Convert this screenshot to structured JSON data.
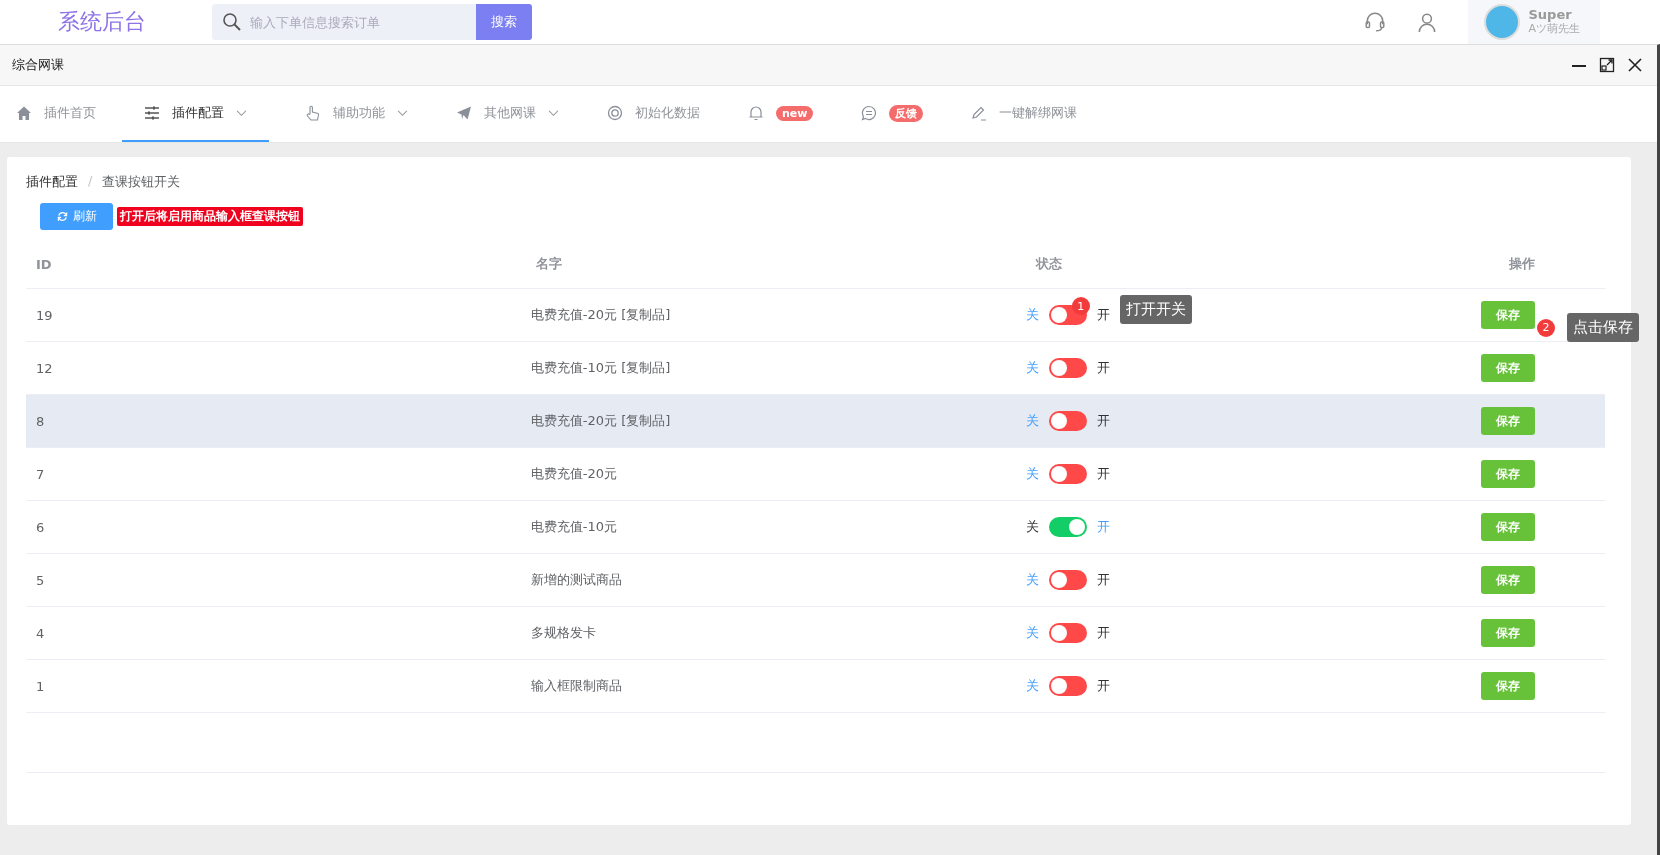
{
  "header": {
    "logo": "系统后台",
    "search": {
      "placeholder": "输入下单信息搜索订单",
      "button": "搜索"
    },
    "user": {
      "name": "Super",
      "subtitle": "Aツ萌先生"
    }
  },
  "window": {
    "title": "综合网课"
  },
  "nav": [
    {
      "kind": "home",
      "label": "插件首页",
      "caret": false,
      "selected": false
    },
    {
      "kind": "sliders",
      "label": "插件配置",
      "caret": true,
      "selected": true
    },
    {
      "kind": "hand",
      "label": "辅助功能",
      "caret": true,
      "selected": false
    },
    {
      "kind": "plane",
      "label": "其他网课",
      "caret": true,
      "selected": false
    },
    {
      "kind": "ring",
      "label": "初始化数据",
      "caret": false,
      "selected": false
    },
    {
      "kind": "bell",
      "badge": "new",
      "caret": false,
      "selected": false
    },
    {
      "kind": "chat",
      "badge": "反馈",
      "caret": false,
      "selected": false
    },
    {
      "kind": "pen",
      "label": "一键解绑网课",
      "caret": false,
      "selected": false
    }
  ],
  "breadcrumb": [
    "插件配置",
    "查课按钮开关"
  ],
  "breadcrumb_separator": "/",
  "refresh_button": "刷新",
  "notice": "打开后将启用商品输入框查课按钮",
  "table": {
    "columns": [
      "ID",
      "名字",
      "状态",
      "操作"
    ],
    "rows": [
      {
        "id": "19",
        "name": "电费充值-20元 [复制品]",
        "off_label": "关",
        "on_label": "开",
        "on": false,
        "action": "保存",
        "highlighted": false,
        "switch_guide": {
          "number": "1",
          "text": "打开开关"
        },
        "save_guide": {
          "number": "2",
          "text": "点击保存"
        }
      },
      {
        "id": "12",
        "name": "电费充值-10元 [复制品]",
        "off_label": "关",
        "on_label": "开",
        "on": false,
        "action": "保存",
        "highlighted": false
      },
      {
        "id": "8",
        "name": "电费充值-20元 [复制品]",
        "off_label": "关",
        "on_label": "开",
        "on": false,
        "action": "保存",
        "highlighted": true
      },
      {
        "id": "7",
        "name": "电费充值-20元",
        "off_label": "关",
        "on_label": "开",
        "on": false,
        "action": "保存",
        "highlighted": false
      },
      {
        "id": "6",
        "name": "电费充值-10元",
        "off_label": "关",
        "on_label": "开",
        "on": true,
        "action": "保存",
        "highlighted": false
      },
      {
        "id": "5",
        "name": "新增的测试商品",
        "off_label": "关",
        "on_label": "开",
        "on": false,
        "action": "保存",
        "highlighted": false
      },
      {
        "id": "4",
        "name": "多规格发卡",
        "off_label": "关",
        "on_label": "开",
        "on": false,
        "action": "保存",
        "highlighted": false
      },
      {
        "id": "1",
        "name": "输入框限制商品",
        "off_label": "关",
        "on_label": "开",
        "on": false,
        "action": "保存",
        "highlighted": false
      }
    ]
  }
}
